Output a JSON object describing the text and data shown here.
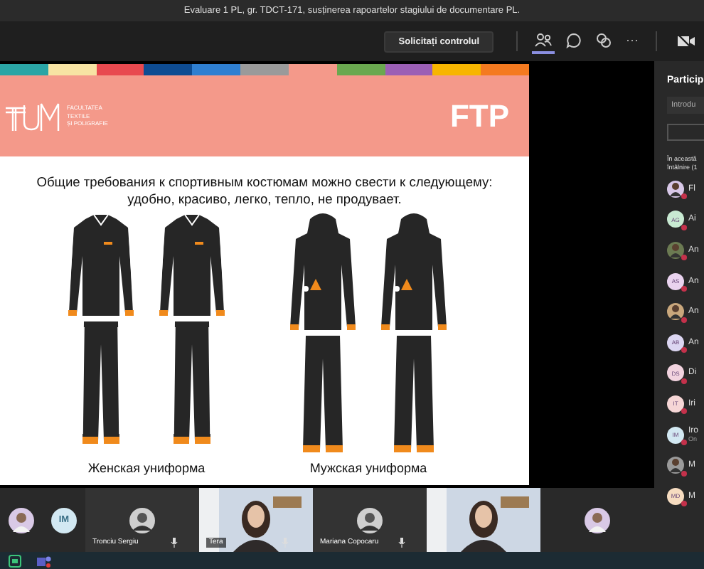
{
  "meeting": {
    "title": "Evaluare 1 PL, gr. TDCT-171, susținerea rapoartelor stagiului de documentare PL."
  },
  "toolbar": {
    "request_control": "Solicitați controlul",
    "more": "···",
    "tabs": [
      {
        "kind": "participants",
        "selected": true
      },
      {
        "kind": "chat",
        "selected": false
      },
      {
        "kind": "rooms",
        "selected": false
      }
    ]
  },
  "slide": {
    "stripe": [
      {
        "color": "#2aa5a5"
      },
      {
        "color": "#f7e3a3"
      },
      {
        "color": "#e8494f"
      },
      {
        "color": "#0e4c92"
      },
      {
        "color": "#2f7fd0"
      },
      {
        "color": "#9a9a9a"
      },
      {
        "color": "#f4998a"
      },
      {
        "color": "#6aa84f"
      },
      {
        "color": "#9b5fb5"
      },
      {
        "color": "#f7b500"
      },
      {
        "color": "#f47a20"
      }
    ],
    "logo": {
      "lines": [
        "FACULTATEA",
        "TEXTILE",
        "ȘI POLIGRAFIE"
      ]
    },
    "badge": "FTP",
    "text_lines": [
      "Общие требования к спортивным костюмам можно свести к следующему:",
      "удобно, красиво, легко, тепло, не продувает."
    ],
    "groups": [
      {
        "caption": "Женская униформа",
        "suits": [
          {
            "kind": "jacket"
          },
          {
            "kind": "jacket"
          }
        ]
      },
      {
        "caption": "Мужская униформа",
        "suits": [
          {
            "kind": "hoodie"
          },
          {
            "kind": "hoodie"
          }
        ]
      }
    ]
  },
  "participants_panel": {
    "title": "Particip",
    "search": {
      "placeholder": "Introdu"
    },
    "section": [
      "În această",
      "întâlnire (1"
    ],
    "people": [
      {
        "name": "Fl",
        "color": "#d8c8e8"
      },
      {
        "kind": "initials",
        "initials": "AG",
        "name": "Ai",
        "color": "#c8ead2"
      },
      {
        "name": "An",
        "color": "#6b7a52"
      },
      {
        "kind": "initials",
        "initials": "AS",
        "name": "An",
        "color": "#ead3ef"
      },
      {
        "name": "An",
        "color": "#c9a77c"
      },
      {
        "kind": "initials",
        "initials": "AB",
        "name": "An",
        "color": "#dcd6f2"
      },
      {
        "kind": "initials",
        "initials": "DS",
        "name": "Di",
        "color": "#f2d3df"
      },
      {
        "kind": "initials",
        "initials": "IT",
        "name": "Iri",
        "color": "#f6d6d6"
      },
      {
        "kind": "initials",
        "initials": "IM",
        "name": "Iro",
        "subtitle": "On",
        "color": "#d2e8f2"
      },
      {
        "name": "M",
        "color": "#9a9a9a"
      },
      {
        "kind": "initials",
        "initials": "MD",
        "name": "M",
        "color": "#f6dcc0"
      }
    ]
  },
  "video_strip": {
    "tiles": [
      {
        "kind": "photo_avatar"
      },
      {
        "kind": "initials",
        "initials": "IM"
      },
      {
        "kind": "avatar",
        "name": "Tronciu Sergiu"
      },
      {
        "kind": "video",
        "name": "Tera"
      },
      {
        "kind": "avatar",
        "name": "Mariana Copocaru"
      },
      {
        "kind": "video"
      },
      {
        "kind": "photo_avatar"
      }
    ]
  }
}
